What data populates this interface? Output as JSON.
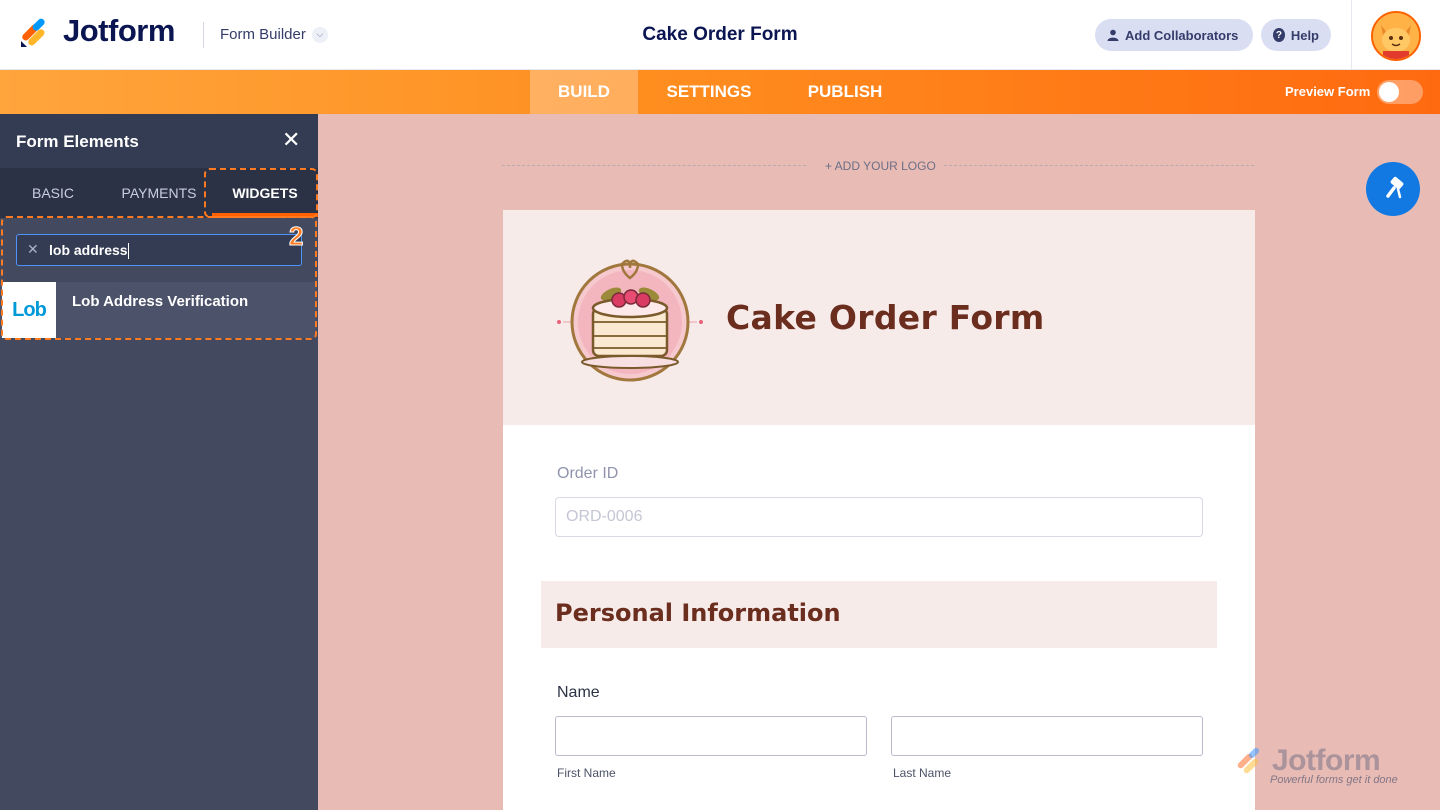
{
  "header": {
    "brand": "Jotform",
    "builder_label": "Form Builder",
    "form_title": "Cake Order Form",
    "collab_label": "Add Collaborators",
    "help_label": "Help"
  },
  "nav": {
    "tabs": [
      "BUILD",
      "SETTINGS",
      "PUBLISH"
    ],
    "active_tab": "BUILD",
    "preview_label": "Preview Form",
    "preview_on": false
  },
  "sidebar": {
    "title": "Form Elements",
    "tabs": [
      "BASIC",
      "PAYMENTS",
      "WIDGETS"
    ],
    "active_tab": "WIDGETS",
    "step_badge": "2",
    "search_value": "lob address",
    "results": [
      {
        "logo_text": "Lob",
        "label": "Lob Address Verification"
      }
    ]
  },
  "canvas": {
    "add_logo": "+ ADD YOUR LOGO",
    "form_heading": "Cake Order Form",
    "order_label": "Order ID",
    "order_placeholder": "ORD-0006",
    "section_title": "Personal Information",
    "name_label": "Name",
    "first_name_label": "First Name",
    "last_name_label": "Last Name"
  },
  "watermark": {
    "brand": "Jotform",
    "tagline": "Powerful forms get it done"
  },
  "colors": {
    "accent": "#ff6100",
    "sidebar_bg": "#434a60",
    "canvas_bg": "#e8bcb5",
    "heading": "#6a2d1e",
    "paint_button": "#1279e2"
  },
  "icons": [
    "jotform-logo-icon",
    "chevron-down-icon",
    "user-icon",
    "help-icon",
    "avatar-icon",
    "close-icon",
    "clear-icon",
    "paint-roller-icon",
    "cake-icon"
  ]
}
